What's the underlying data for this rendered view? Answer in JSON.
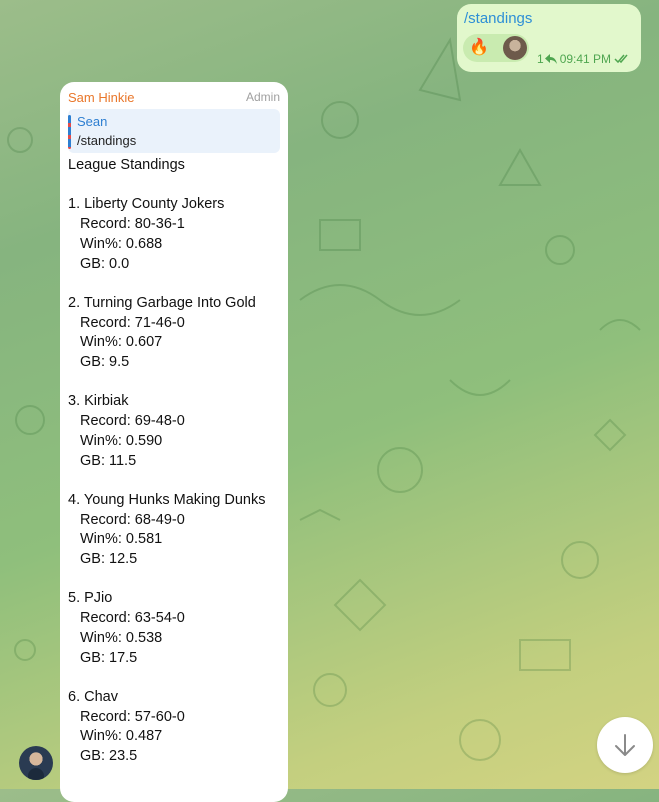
{
  "outgoing": {
    "text": "/standings",
    "reaction_emoji": "🔥",
    "reply_count": "1",
    "time": "09:41 PM",
    "status_icon": "double-check-icon"
  },
  "incoming": {
    "sender": "Sam Hinkie",
    "role": "Admin",
    "reply": {
      "name": "Sean",
      "text": "/standings"
    },
    "title": "League Standings",
    "teams": [
      {
        "heading": "1. Liberty County Jokers",
        "record": "Record: 80-36-1",
        "winpct": "Win%: 0.688",
        "gb": "GB: 0.0"
      },
      {
        "heading": "2. Turning Garbage Into Gold",
        "record": "Record: 71-46-0",
        "winpct": "Win%: 0.607",
        "gb": "GB: 9.5"
      },
      {
        "heading": "3. Kirbiak",
        "record": "Record: 69-48-0",
        "winpct": "Win%: 0.590",
        "gb": "GB: 11.5"
      },
      {
        "heading": "4. Young Hunks Making Dunks",
        "record": "Record: 68-49-0",
        "winpct": "Win%: 0.581",
        "gb": "GB: 12.5"
      },
      {
        "heading": "5. PJio",
        "record": "Record: 63-54-0",
        "winpct": "Win%: 0.538",
        "gb": "GB: 17.5"
      },
      {
        "heading": "6. Chav",
        "record": "Record: 57-60-0",
        "winpct": "Win%: 0.487",
        "gb": "GB: 23.5"
      }
    ]
  },
  "colors": {
    "outgoing_bubble": "#e2f8cc",
    "incoming_bubble": "#ffffff",
    "link_blue": "#2e8fd6",
    "sender_orange": "#e9772b",
    "meta_green": "#4fa650"
  }
}
